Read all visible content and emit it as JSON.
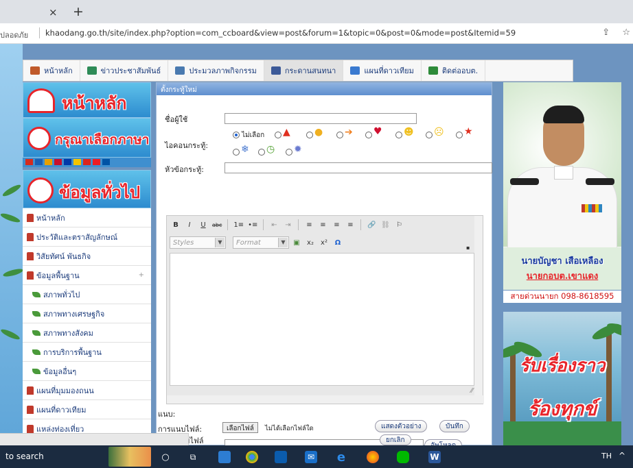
{
  "browser": {
    "tab_close": "×",
    "tab_new": "+",
    "security_label": "ปลอดภัย",
    "url": "khaodang.go.th/site/index.php?option=com_ccboard&view=post&forum=1&topic=0&post=0&mode=post&Itemid=59",
    "share_icon": "⇪",
    "star_icon": "☆"
  },
  "nav": {
    "items": [
      {
        "label": "หน้าหลัก",
        "icon": "home-icon",
        "color": "#c05a2a"
      },
      {
        "label": "ข่าวประชาสัมพันธ์",
        "icon": "megaphone-icon",
        "color": "#2e8b57"
      },
      {
        "label": "ประมวลภาพกิจกรรม",
        "icon": "camera-icon",
        "color": "#4a7ab0"
      },
      {
        "label": "กระดานสนทนา",
        "icon": "facebook-icon",
        "color": "#3b5998"
      },
      {
        "label": "แผนที่ดาวเทียม",
        "icon": "map-icon",
        "color": "#3a7ad0"
      },
      {
        "label": "ติดต่ออบต.",
        "icon": "phone-icon",
        "color": "#2e8b3a"
      }
    ]
  },
  "left": {
    "banner_home": "หน้าหลัก",
    "banner_language": "กรุณาเลือกภาษา",
    "banner_info": "ข้อมูลทั่วไป",
    "flag_colors": [
      "#d52b1e",
      "#1a5fb4",
      "#e8a000",
      "#c8102e",
      "#0038a8",
      "#f4c400",
      "#da251d",
      "#ed1c24",
      "#0052a5"
    ],
    "menu": [
      {
        "label": "หน้าหลัก",
        "sub": false,
        "arrow": ""
      },
      {
        "label": "ประวัติและตราสัญลักษณ์",
        "sub": false,
        "arrow": ""
      },
      {
        "label": "วิสัยทัศน์ พันธกิจ",
        "sub": false,
        "arrow": ""
      },
      {
        "label": "ข้อมูลพื้นฐาน",
        "sub": false,
        "arrow": "+"
      },
      {
        "label": "สภาพทั่วไป",
        "sub": true,
        "arrow": ""
      },
      {
        "label": "สภาพทางเศรษฐกิจ",
        "sub": true,
        "arrow": ""
      },
      {
        "label": "สภาพทางสังคม",
        "sub": true,
        "arrow": ""
      },
      {
        "label": "การบริการพื้นฐาน",
        "sub": true,
        "arrow": ""
      },
      {
        "label": "ข้อมูลอื่นๆ",
        "sub": true,
        "arrow": ""
      },
      {
        "label": "แผนที่มุมมองถนน",
        "sub": false,
        "arrow": ""
      },
      {
        "label": "แผนที่ดาวเทียม",
        "sub": false,
        "arrow": ""
      },
      {
        "label": "แหล่งท่องเที่ยว",
        "sub": false,
        "arrow": ""
      }
    ]
  },
  "form": {
    "title": "ตั้งกระทู้ใหม่",
    "username_label": "ชื่อผู้ใช้",
    "username_value": "",
    "icon_label": "ไอคอนกระทู้:",
    "icon_none": "ไม่เลือก",
    "subject_label": "หัวข้อกระทู้:",
    "subject_value": "",
    "styles": "Styles",
    "format": "Format",
    "toolbar": {
      "bold": "B",
      "italic": "I",
      "underline": "U",
      "strike": "abc",
      "ol": "1≡",
      "ul": "•≡",
      "outdent": "⇤",
      "indent": "⇥",
      "align_left": "≡",
      "align_center": "≡",
      "align_right": "≡",
      "justify": "≡",
      "link": "🔗",
      "unlink": "⛓",
      "anchor": "⚐",
      "image": "▣",
      "sub": "x₂",
      "sup": "x²",
      "omega": "Ω"
    },
    "attach_label": "การแนบไฟล์:",
    "choose_file": "เลือกไฟล์",
    "no_file": "ไม่ได้เลือกไฟล์ใด",
    "desc_label_1": "คำอธิบายไฟล์",
    "desc_label_2": "แนบ:",
    "upload": "อัพโหลด",
    "preview": "แสดงตัวอย่าง",
    "save": "บันทึก",
    "cancel": "ยกเลิก"
  },
  "right": {
    "name_1": "นายบัญชา เสือเหลือง",
    "name_2": "นายกอบต.เขาแดง",
    "hotline": "สายด่วนนายก 098-8618595",
    "promo_1": "รับเรื่องราว",
    "promo_2": "ร้องทุกข์"
  },
  "taskbar": {
    "search": "to search",
    "lang": "TH",
    "up": "^"
  }
}
